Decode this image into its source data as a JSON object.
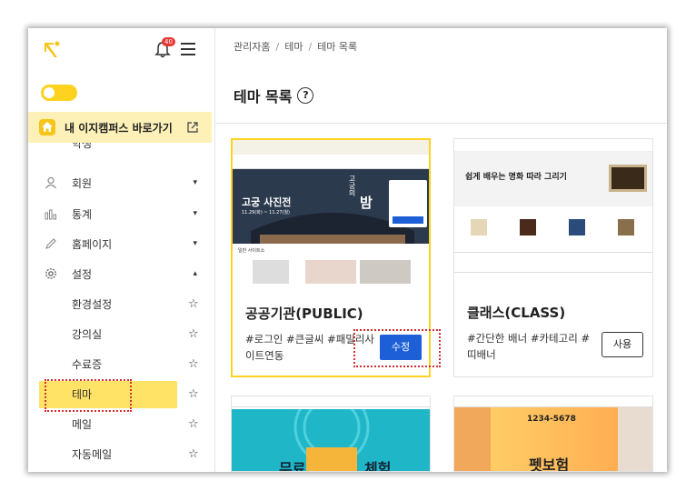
{
  "sidebar": {
    "notification_count": "40",
    "campus_link_label": "내 이지캠퍼스 바로가기",
    "partial_item": "학생",
    "menu": [
      {
        "label": "회원",
        "icon": "user-icon"
      },
      {
        "label": "통계",
        "icon": "bar-chart-icon"
      },
      {
        "label": "홈페이지",
        "icon": "pencil-icon"
      },
      {
        "label": "설정",
        "icon": "gear-icon"
      }
    ],
    "submenu": [
      {
        "label": "환경설정"
      },
      {
        "label": "강의실"
      },
      {
        "label": "수료증"
      },
      {
        "label": "테마",
        "active": true
      },
      {
        "label": "메일"
      },
      {
        "label": "자동메일"
      }
    ]
  },
  "breadcrumb": [
    "관리자홈",
    "테마",
    "테마 목록"
  ],
  "page_title": "테마 목록",
  "help_icon": "?",
  "cards": [
    {
      "title": "공공기관(PUBLIC)",
      "tags": "#로그인 #큰글씨 #패밀리사이트연동",
      "button": "수정",
      "thumb_text": {
        "banner": "고궁 사진전",
        "sub": "고궁의",
        "night": "밤",
        "date": "11.29(화) ~ 11.27(월)",
        "section": "일반 사이트소"
      }
    },
    {
      "title": "클래스(CLASS)",
      "tags": "#간단한 배너 #카테고리 #띠배너",
      "button": "사용",
      "thumb_text": {
        "banner": "쉽게 배우는 명화 따라 그리기"
      }
    },
    {
      "thumb_text": {
        "banner_a": "무료",
        "banner_b": "체험"
      }
    },
    {
      "thumb_text": {
        "phone": "1234-5678",
        "promo": "펫보험"
      }
    }
  ],
  "colors": {
    "accent": "#ffd21f",
    "active_bg": "#ffe366",
    "edit_button": "#1d5fd6",
    "highlight_border": "#d32f2f"
  }
}
